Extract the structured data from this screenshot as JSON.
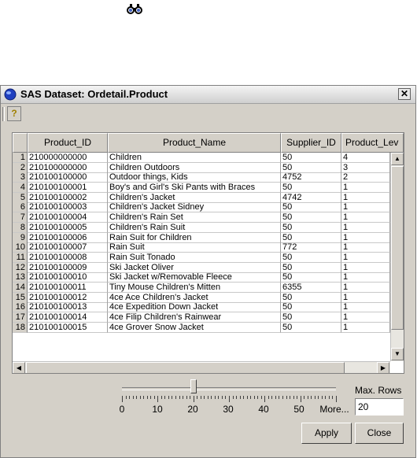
{
  "window": {
    "title": "SAS Dataset: Ordetail.Product",
    "close_label": "✕",
    "help_label": "?"
  },
  "table": {
    "columns": [
      "Product_ID",
      "Product_Name",
      "Supplier_ID",
      "Product_Lev"
    ],
    "rows": [
      {
        "n": "1",
        "id": "210000000000",
        "name": "Children",
        "sup": "50",
        "lev": "4"
      },
      {
        "n": "2",
        "id": "210100000000",
        "name": "Children Outdoors",
        "sup": "50",
        "lev": "3"
      },
      {
        "n": "3",
        "id": "210100100000",
        "name": "Outdoor things, Kids",
        "sup": "4752",
        "lev": "2"
      },
      {
        "n": "4",
        "id": "210100100001",
        "name": "Boy's and Girl's Ski Pants with Braces",
        "sup": "50",
        "lev": "1"
      },
      {
        "n": "5",
        "id": "210100100002",
        "name": "Children's Jacket",
        "sup": "4742",
        "lev": "1"
      },
      {
        "n": "6",
        "id": "210100100003",
        "name": "Children's Jacket Sidney",
        "sup": "50",
        "lev": "1"
      },
      {
        "n": "7",
        "id": "210100100004",
        "name": "Children's Rain Set",
        "sup": "50",
        "lev": "1"
      },
      {
        "n": "8",
        "id": "210100100005",
        "name": "Children's Rain Suit",
        "sup": "50",
        "lev": "1"
      },
      {
        "n": "9",
        "id": "210100100006",
        "name": "Rain Suit for Children",
        "sup": "50",
        "lev": "1"
      },
      {
        "n": "10",
        "id": "210100100007",
        "name": "Rain Suit",
        "sup": "772",
        "lev": "1"
      },
      {
        "n": "11",
        "id": "210100100008",
        "name": "Rain Suit Tonado",
        "sup": "50",
        "lev": "1"
      },
      {
        "n": "12",
        "id": "210100100009",
        "name": "Ski Jacket Oliver",
        "sup": "50",
        "lev": "1"
      },
      {
        "n": "13",
        "id": "210100100010",
        "name": "Ski Jacket w/Removable Fleece",
        "sup": "50",
        "lev": "1"
      },
      {
        "n": "14",
        "id": "210100100011",
        "name": "Tiny Mouse Children's Mitten",
        "sup": "6355",
        "lev": "1"
      },
      {
        "n": "15",
        "id": "210100100012",
        "name": "4ce Ace Children's Jacket",
        "sup": "50",
        "lev": "1"
      },
      {
        "n": "16",
        "id": "210100100013",
        "name": "4ce Expedition Down Jacket",
        "sup": "50",
        "lev": "1"
      },
      {
        "n": "17",
        "id": "210100100014",
        "name": "4ce Filip Children's Rainwear",
        "sup": "50",
        "lev": "1"
      },
      {
        "n": "18",
        "id": "210100100015",
        "name": "4ce Grover Snow Jacket",
        "sup": "50",
        "lev": "1"
      }
    ]
  },
  "slider": {
    "labels": [
      "0",
      "10",
      "20",
      "30",
      "40",
      "50",
      "More..."
    ],
    "value": 20
  },
  "max_rows": {
    "label": "Max. Rows",
    "value": "20"
  },
  "buttons": {
    "apply": "Apply",
    "close": "Close"
  }
}
